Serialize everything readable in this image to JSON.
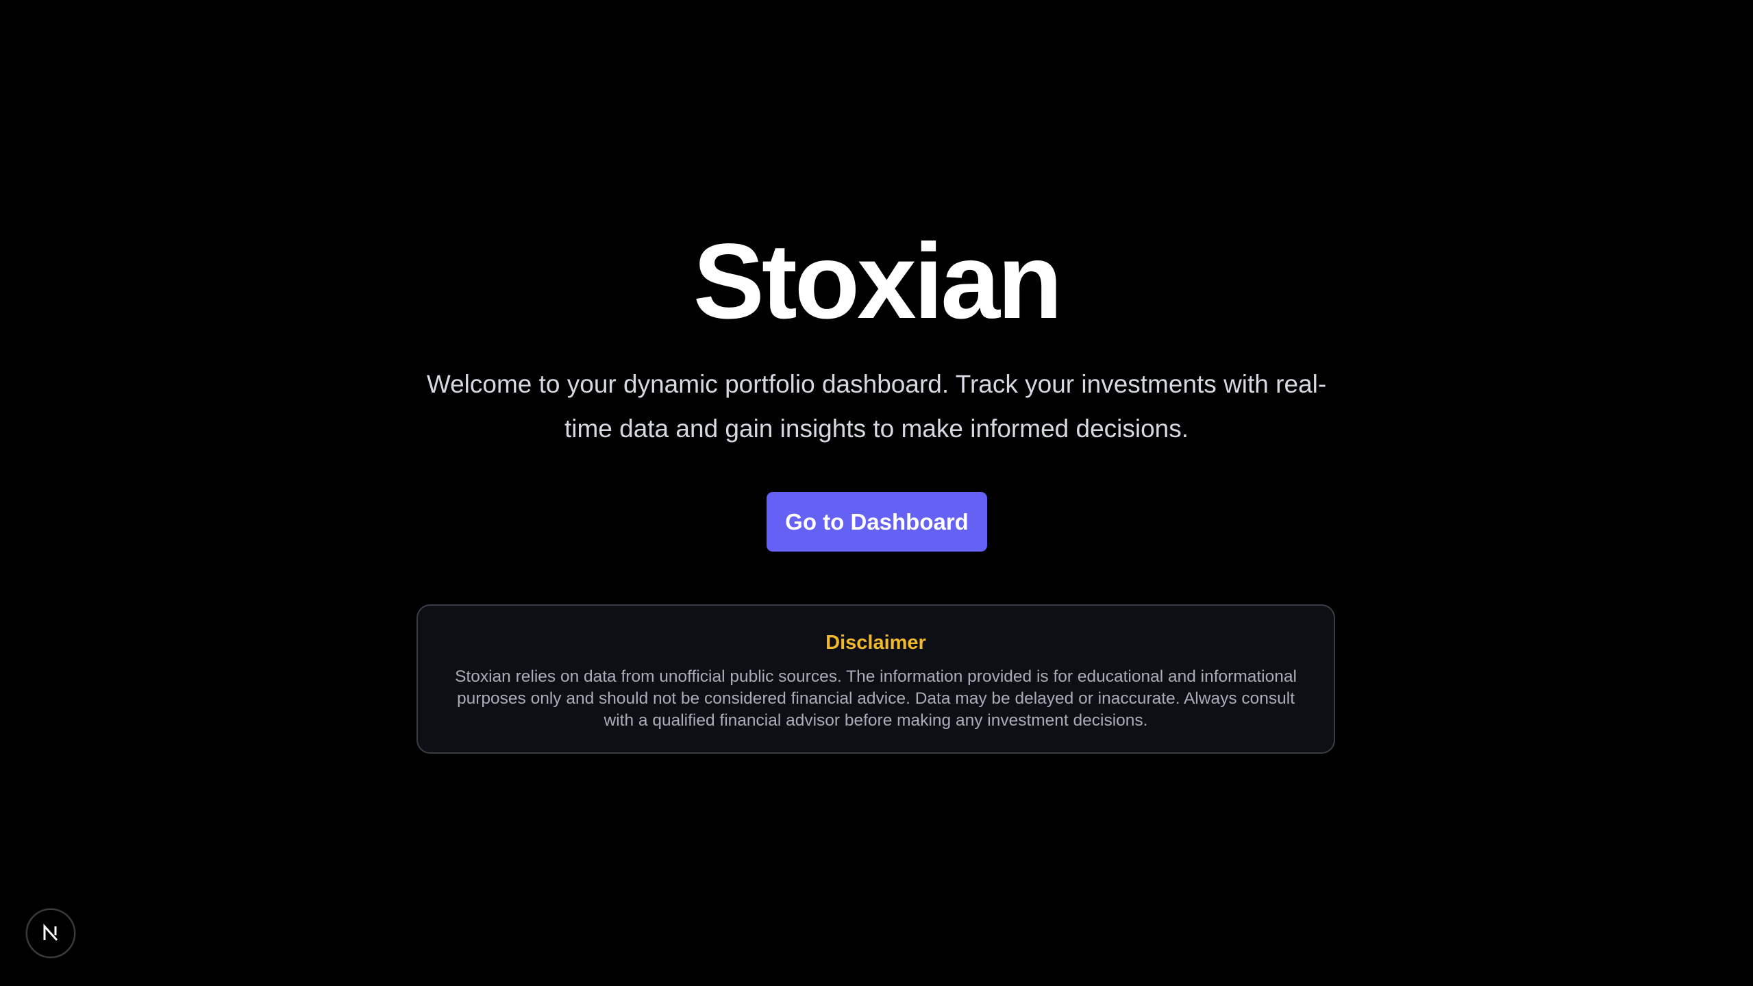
{
  "hero": {
    "title": "Stoxian",
    "subtitle": "Welcome to your dynamic portfolio dashboard. Track your investments with real-time data and gain insights to make informed decisions.",
    "cta_label": "Go to Dashboard"
  },
  "disclaimer": {
    "title": "Disclaimer",
    "body": "Stoxian relies on data from unofficial public sources. The information provided is for educational and informational purposes only and should not be considered financial advice. Data may be delayed or inaccurate. Always consult with a qualified financial advisor before making any investment decisions."
  },
  "dev_badge": {
    "icon": "nextjs-icon"
  },
  "colors": {
    "background": "#000000",
    "accent": "#6461f4",
    "disclaimer_title": "#f3b82c",
    "disclaimer_border": "#3a3d45",
    "disclaimer_bg": "#0d0f14"
  }
}
